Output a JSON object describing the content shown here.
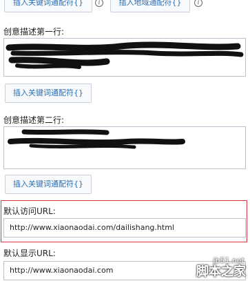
{
  "top_buttons": {
    "insert_keyword_label": "插入关键词通配符{}",
    "insert_region_label": "插入地域通配符{}",
    "help_icon": "info-icon"
  },
  "desc_line1": {
    "label": "创意描述第一行:",
    "button_label": "插入关键词通配符{}"
  },
  "desc_line2": {
    "label": "创意描述第二行:",
    "button_label": "插入关键词通配符{}"
  },
  "default_visit_url": {
    "label": "默认访问URL:",
    "value": "http://www.xiaonaodai.com/dailishang.html"
  },
  "default_display_url": {
    "label": "默认显示URL:",
    "value": "http://www.xiaonaodai.com"
  },
  "watermark": {
    "site": "jb51.net",
    "brand": "脚本之家"
  },
  "colors": {
    "highlight_border": "#d9363e",
    "button_text": "#2d6fb3"
  }
}
